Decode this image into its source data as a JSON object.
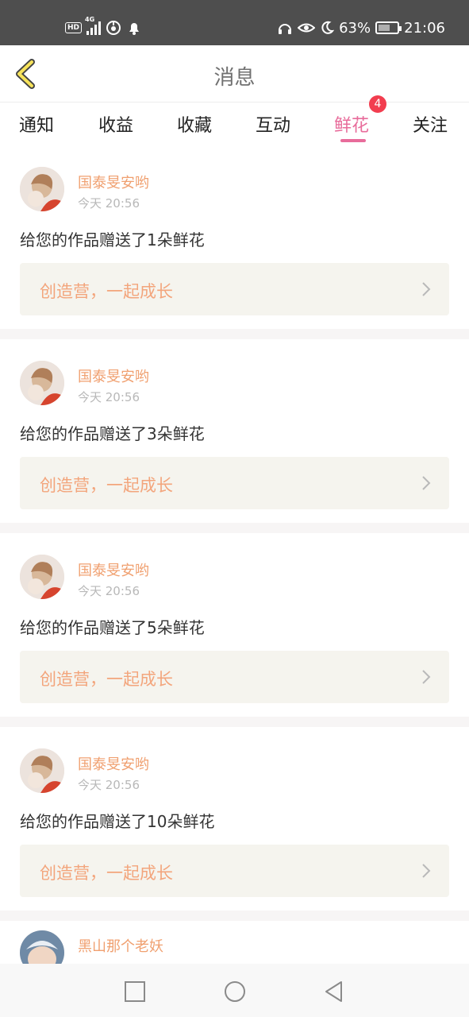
{
  "status_bar": {
    "hd": "HD",
    "network": "4G",
    "battery_percent": "63%",
    "time": "21:06",
    "battery_level": 0.63
  },
  "header": {
    "title": "消息",
    "back_icon": "chevron-left-icon"
  },
  "tabs": [
    {
      "label": "通知"
    },
    {
      "label": "收益"
    },
    {
      "label": "收藏"
    },
    {
      "label": "互动"
    },
    {
      "label": "鲜花",
      "active": true,
      "badge": "4"
    },
    {
      "label": "关注"
    }
  ],
  "accent_color": "#e86c9b",
  "items": [
    {
      "user": "国泰旻安哟",
      "time": "今天 20:56",
      "message": "给您的作品赠送了1朵鲜花",
      "promo": "创造营，一起成长"
    },
    {
      "user": "国泰旻安哟",
      "time": "今天 20:56",
      "message": "给您的作品赠送了3朵鲜花",
      "promo": "创造营，一起成长"
    },
    {
      "user": "国泰旻安哟",
      "time": "今天 20:56",
      "message": "给您的作品赠送了5朵鲜花",
      "promo": "创造营，一起成长"
    },
    {
      "user": "国泰旻安哟",
      "time": "今天 20:56",
      "message": "给您的作品赠送了10朵鲜花",
      "promo": "创造营，一起成长"
    },
    {
      "user": "黑山那个老妖"
    }
  ],
  "nav_bar": {
    "icons": [
      "square-icon",
      "circle-icon",
      "triangle-back-icon"
    ]
  }
}
